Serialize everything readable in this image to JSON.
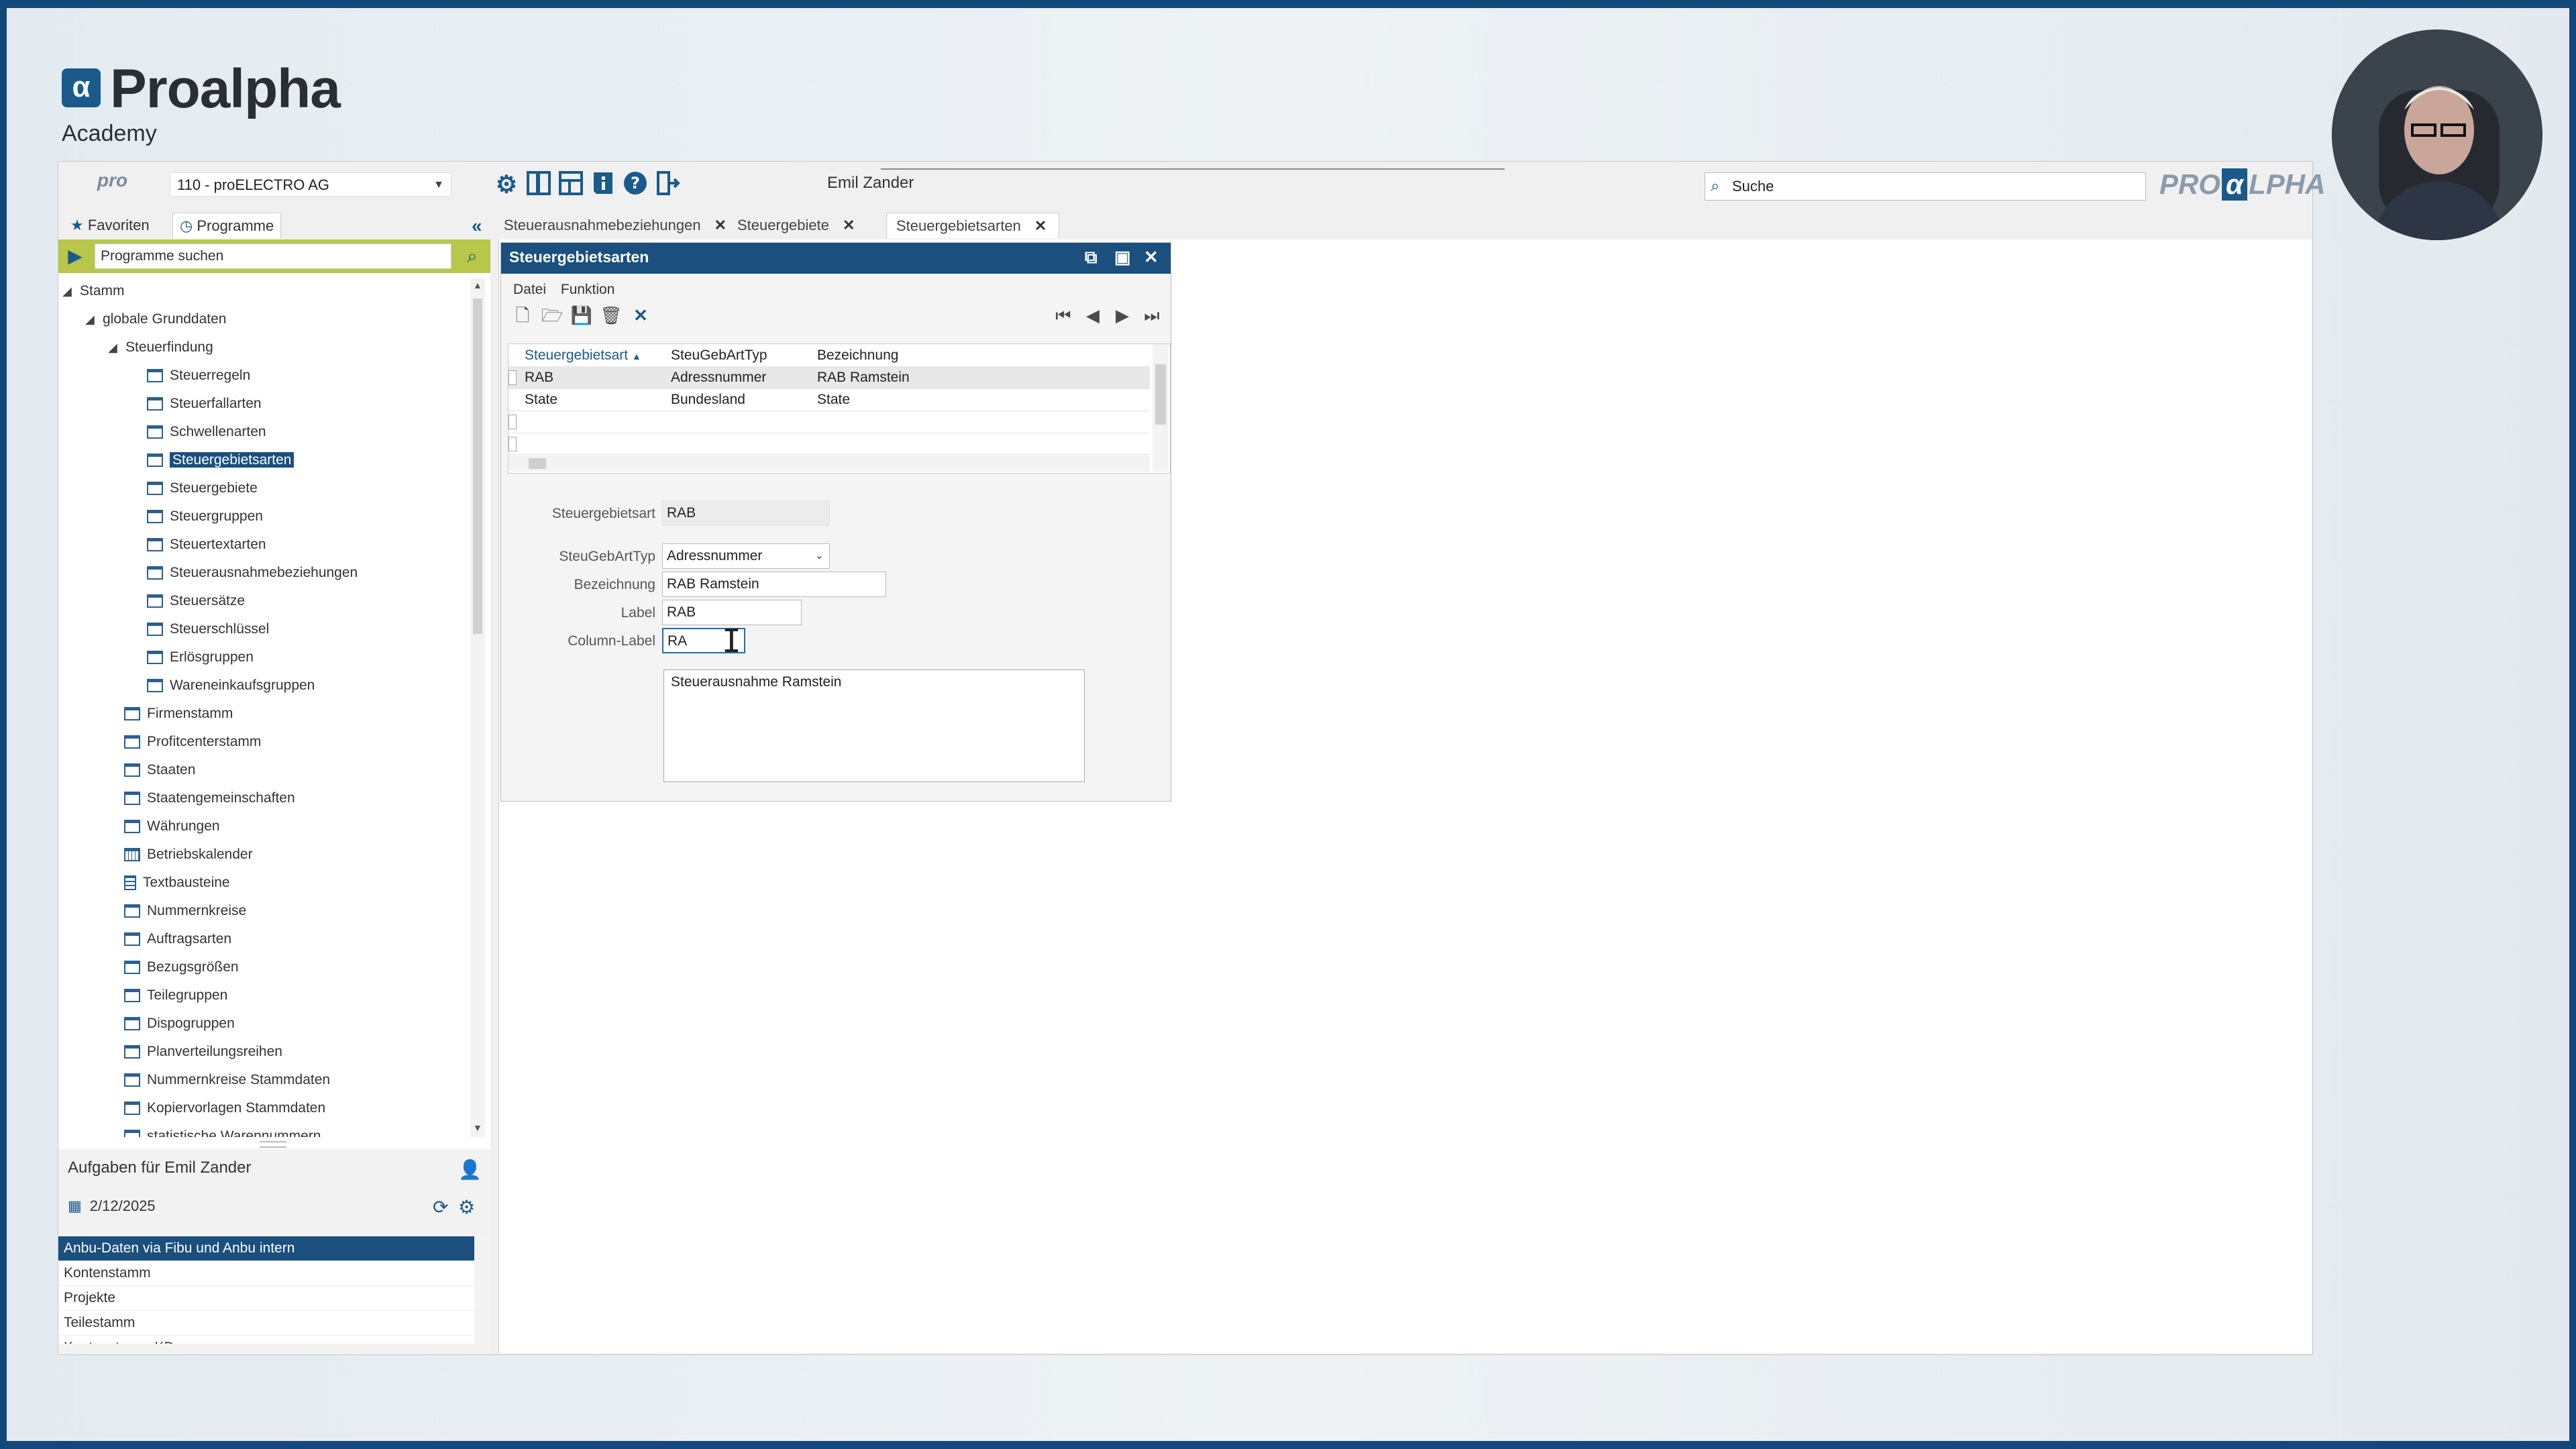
{
  "branding": {
    "logo_mark": "α",
    "name": "Proalpha",
    "subtitle": "Academy",
    "right_brand_pre": "PRO",
    "right_brand_alpha": "α",
    "right_brand_post": "LPHA"
  },
  "topbar": {
    "pro_badge": "pro",
    "company": "110 - proELECTRO AG",
    "user": "Emil Zander",
    "search_placeholder": "Suche",
    "icons": [
      "gear-icon",
      "panel-icon",
      "layout-icon",
      "info-icon",
      "help-icon",
      "exit-icon"
    ]
  },
  "left_tabs": [
    "Favoriten",
    "Programme"
  ],
  "doc_tabs": [
    {
      "label": "Steuerausnahmebeziehungen"
    },
    {
      "label": "Steuergebiete"
    },
    {
      "label": "Steuergebietsarten",
      "active": true
    }
  ],
  "nav": {
    "search_placeholder": "Programme suchen",
    "tree": [
      {
        "label": "Stamm"
      },
      {
        "label": "globale Grunddaten"
      },
      {
        "label": "Steuerfindung"
      },
      {
        "label": "Steuerregeln"
      },
      {
        "label": "Steuerfallarten"
      },
      {
        "label": "Schwellenarten"
      },
      {
        "label": "Steuergebietsarten",
        "selected": true
      },
      {
        "label": "Steuergebiete"
      },
      {
        "label": "Steuergruppen"
      },
      {
        "label": "Steuertextarten"
      },
      {
        "label": "Steuerausnahmebeziehungen"
      },
      {
        "label": "Steuersätze"
      },
      {
        "label": "Steuerschlüssel"
      },
      {
        "label": "Erlösgruppen"
      },
      {
        "label": "Wareneinkaufsgruppen"
      },
      {
        "label": "Firmenstamm"
      },
      {
        "label": "Profitcenterstamm"
      },
      {
        "label": "Staaten"
      },
      {
        "label": "Staatengemeinschaften"
      },
      {
        "label": "Währungen"
      },
      {
        "label": "Betriebskalender"
      },
      {
        "label": "Textbausteine"
      },
      {
        "label": "Nummernkreise"
      },
      {
        "label": "Auftragsarten"
      },
      {
        "label": "Bezugsgrößen"
      },
      {
        "label": "Teilegruppen"
      },
      {
        "label": "Dispogruppen"
      },
      {
        "label": "Planverteilungsreihen"
      },
      {
        "label": "Nummernkreise Stammdaten"
      },
      {
        "label": "Kopiervorlagen Stammdaten"
      },
      {
        "label": "statistische Warennummern"
      }
    ]
  },
  "tasks": {
    "title": "Aufgaben für Emil Zander",
    "date": "2/12/2025",
    "items": [
      {
        "label": "Anbu-Daten via Fibu und Anbu intern",
        "selected": true
      },
      {
        "label": "Kontenstamm"
      },
      {
        "label": "Projekte"
      },
      {
        "label": "Teilestamm"
      },
      {
        "label": "Kontenstamm KD"
      }
    ]
  },
  "window": {
    "title": "Steuergebietsarten",
    "menu": [
      "Datei",
      "Funktion"
    ],
    "grid": {
      "columns": [
        "Steuergebietsart",
        "SteuGebArtTyp",
        "Bezeichnung"
      ],
      "rows": [
        [
          "RAB",
          "Adressnummer",
          "RAB Ramstein"
        ],
        [
          "State",
          "Bundesland",
          "State"
        ]
      ]
    },
    "form": {
      "steuergebietsart_label": "Steuergebietsart",
      "steuergebietsart_value": "RAB",
      "typ_label": "SteuGebArtTyp",
      "typ_value": "Adressnummer",
      "bezeichnung_label": "Bezeichnung",
      "bezeichnung_value": "RAB Ramstein",
      "label_label": "Label",
      "label_value": "RAB",
      "column_label_label": "Column-Label",
      "column_label_value": "RA",
      "memo": "Steuerausnahme Ramstein"
    }
  }
}
